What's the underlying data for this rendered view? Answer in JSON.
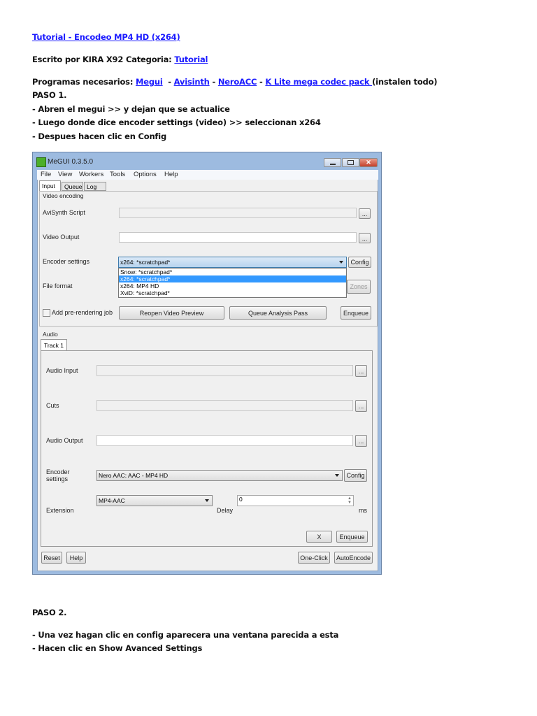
{
  "doc": {
    "title": "Tutorial - Encodeo MP4 HD (x264)",
    "author_line": "Escrito por KIRA X92 Categoria: ",
    "category_link": "Tutorial",
    "programs_label": "Programas necesarios: ",
    "programs": [
      "Megui",
      "Avisinth",
      "NeroACC",
      "K Lite mega codec pack "
    ],
    "sep": " - ",
    "programs_note": "(instalen todo)",
    "paso1": "PASO 1.",
    "steps1": [
      "- Abren el megui >> y dejan que se actualice",
      "- Luego donde dice encoder settings (video) >> seleccionan x264",
      "- Despues hacen clic en Config"
    ],
    "paso2": "PASO 2.",
    "steps2": [
      "- Una vez hagan clic en config aparecera una ventana parecida a esta",
      "- Hacen clic en Show Avanced Settings"
    ]
  },
  "app": {
    "title": "MeGUI 0.3.5.0",
    "menu": [
      "File",
      "View",
      "Workers",
      "Tools",
      "Options",
      "Help"
    ],
    "tabs": [
      "Input",
      "Queue",
      "Log"
    ],
    "video": {
      "group": "Video encoding",
      "avisynth_label": "AviSynth Script",
      "output_label": "Video Output",
      "encoder_label": "Encoder settings",
      "encoder_value": "x264: *scratchpad*",
      "encoder_options": [
        "Snow: *scratchpad*",
        "x264: *scratchpad*",
        "x264: MP4 HD",
        "XviD: *scratchpad*"
      ],
      "fileformat_label": "File format",
      "config": "Config",
      "zones": "Zones",
      "browse": "...",
      "prerender": "Add pre-rendering job",
      "reopen": "Reopen Video Preview",
      "analysis": "Queue Analysis Pass",
      "enqueue": "Enqueue"
    },
    "audio": {
      "group": "Audio",
      "track_tab": "Track 1",
      "input_label": "Audio Input",
      "cuts_label": "Cuts",
      "output_label": "Audio Output",
      "encoder_label_1": "Encoder",
      "encoder_label_2": "settings",
      "encoder_value": "Nero AAC: AAC - MP4 HD",
      "config": "Config",
      "extension_label": "Extension",
      "extension_value": "MP4-AAC",
      "delay_label": "Delay",
      "delay_value": "0",
      "ms": "ms",
      "x": "X",
      "enqueue": "Enqueue"
    },
    "bottom": {
      "reset": "Reset",
      "help": "Help",
      "oneclick": "One-Click",
      "autoencode": "AutoEncode"
    }
  }
}
